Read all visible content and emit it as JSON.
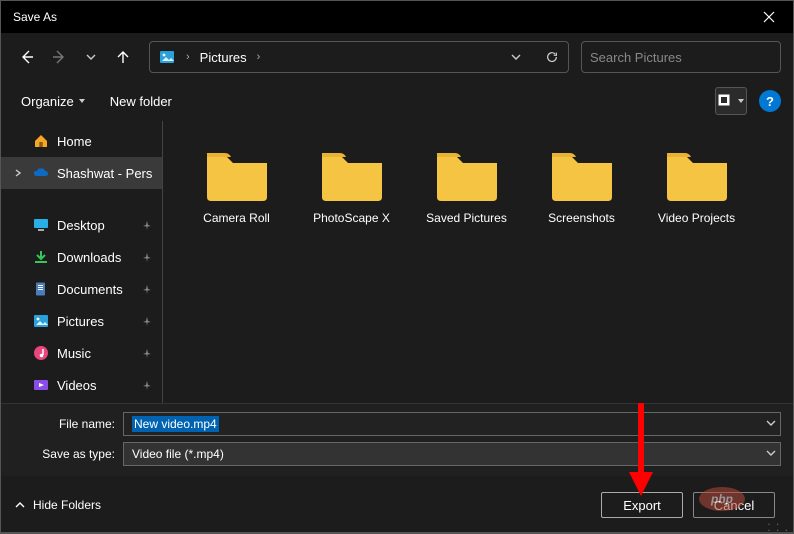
{
  "title": "Save As",
  "nav": {
    "current_folder": "Pictures"
  },
  "search": {
    "placeholder": "Search Pictures"
  },
  "toolbar": {
    "organize": "Organize",
    "newfolder": "New folder"
  },
  "sidebar": {
    "home": "Home",
    "onedrive": "Shashwat - Pers",
    "desktop": "Desktop",
    "downloads": "Downloads",
    "documents": "Documents",
    "pictures": "Pictures",
    "music": "Music",
    "videos": "Videos"
  },
  "folders": {
    "f0": "Camera Roll",
    "f1": "PhotoScape X",
    "f2": "Saved Pictures",
    "f3": "Screenshots",
    "f4": "Video Projects"
  },
  "fields": {
    "filename_label": "File name:",
    "filename_value": "New video.mp4",
    "type_label": "Save as type:",
    "type_value": "Video file (*.mp4)"
  },
  "footer": {
    "hidefolders": "Hide Folders",
    "export": "Export",
    "cancel": "Cancel"
  },
  "help": "?",
  "watermark": {
    "t1": "php",
    "t2": ""
  }
}
